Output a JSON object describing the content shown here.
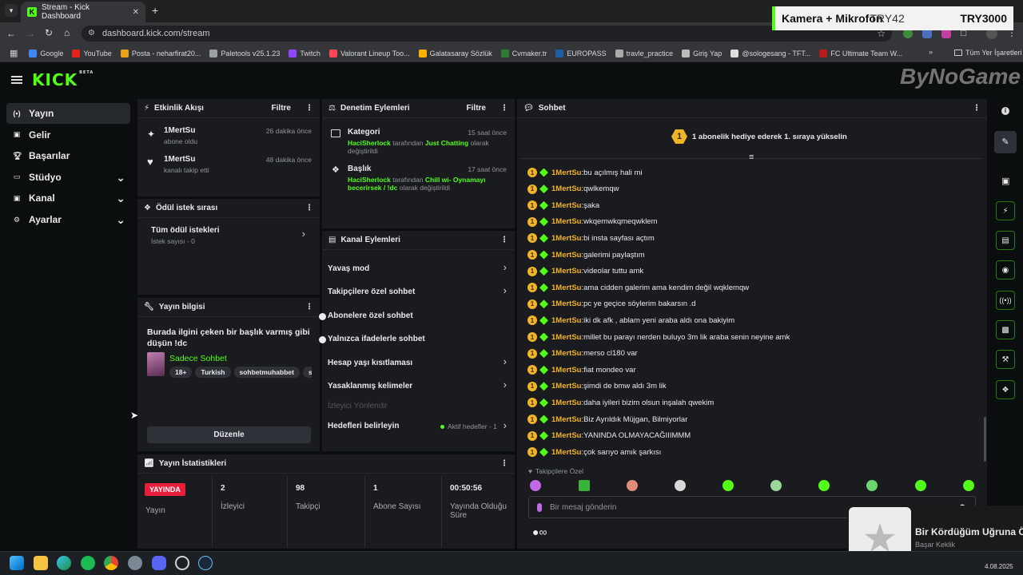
{
  "browser": {
    "tab_title": "Stream - Kick Dashboard",
    "url": "dashboard.kick.com/stream",
    "bookmarks": [
      "Google",
      "YouTube",
      "Posta - neharfirat20...",
      "Paletools v25.1.23",
      "Twitch",
      "Valorant Lineup Too...",
      "Galatasaray Sözlük",
      "Cvmaker.tr",
      "EUROPASS",
      "travle_practice",
      "Giriş Yap",
      "@sologesang - TFT...",
      "FC Ultimate Team W..."
    ],
    "bookmarks_more": "»",
    "all_bookmarks": "Tüm Yer İşaretleri"
  },
  "overlay": {
    "camera_label": "Kamera + Mikrofon",
    "price_a": "TRY42",
    "price_b": "TRY3000",
    "watermark": "ByNoGame"
  },
  "app": {
    "logo": "KICK",
    "logo_beta": "BETA"
  },
  "sidebar": {
    "items": [
      {
        "label": "Yayın",
        "icon": "broadcast-icon",
        "expand": false
      },
      {
        "label": "Gelir",
        "icon": "revenue-icon",
        "expand": false
      },
      {
        "label": "Başarılar",
        "icon": "trophy-icon",
        "expand": false
      },
      {
        "label": "Stüdyo",
        "icon": "studio-icon",
        "expand": true
      },
      {
        "label": "Kanal",
        "icon": "channel-icon",
        "expand": true
      },
      {
        "label": "Ayarlar",
        "icon": "settings-icon",
        "expand": true
      }
    ]
  },
  "activity": {
    "title": "Etkinlik Akışı",
    "filter": "Filtre",
    "events": [
      {
        "user": "1MertSu",
        "action": "abone oldu",
        "time": "26 dakika önce"
      },
      {
        "user": "1MertSu",
        "action": "kanalı takip etti",
        "time": "48 dakika önce"
      }
    ]
  },
  "moderation": {
    "title": "Denetim Eylemleri",
    "filter": "Filtre",
    "items": [
      {
        "title": "Kategori",
        "time": "15 saat önce",
        "mod": "HaciSherlock",
        "mid": " tarafından ",
        "value": "Just Chatting",
        "tail": " olarak değiştirildi"
      },
      {
        "title": "Başlık",
        "time": "17 saat önce",
        "mod": "HaciSherlock",
        "mid": " tarafından ",
        "value": "Chill wi- Oynamayı becerirsek / !dc",
        "tail": " olarak değiştirildi"
      }
    ]
  },
  "rewards": {
    "title": "Ödül istek sırası",
    "all": "Tüm ödül istekleri",
    "count": "İstek sayısı - 0"
  },
  "stream_info": {
    "title": "Yayın bilgisi",
    "stream_title": "Burada ilgini çeken bir başlık varmış gibi düşün !dc",
    "category": "Sadece Sohbet",
    "tags": [
      "18+",
      "Turkish",
      "sohbetmuhabbet",
      "sıkıl"
    ],
    "edit": "Düzenle"
  },
  "channel_actions": {
    "title": "Kanal Eylemleri",
    "items": [
      {
        "label": "Yavaş mod",
        "type": "chevron"
      },
      {
        "label": "Takipçilere özel sohbet",
        "type": "chevron"
      },
      {
        "label": "Abonelere özel sohbet",
        "type": "toggle"
      },
      {
        "label": "Yalnızca ifadelerle sohbet",
        "type": "toggle"
      },
      {
        "label": "Hesap yaşı kısıtlaması",
        "type": "chevron"
      },
      {
        "label": "Yasaklanmış kelimeler",
        "type": "chevron"
      }
    ],
    "viewer_redirect": "İzleyici Yönlendir",
    "goals": "Hedefleri belirleyin",
    "goals_status": "Aktif hedefler - 1"
  },
  "stats": {
    "title": "Yayın İstatistikleri",
    "live_badge": "YAYINDA",
    "cols": [
      {
        "value": "",
        "label": "Yayın"
      },
      {
        "value": "2",
        "label": "İzleyici"
      },
      {
        "value": "98",
        "label": "Takipçi"
      },
      {
        "value": "1",
        "label": "Abone Sayısı"
      },
      {
        "value": "00:50:56",
        "label": "Yayında Olduğu Süre"
      }
    ]
  },
  "chat": {
    "title": "Sohbet",
    "pinned_badge": "1",
    "pinned": "1 abonelik hediye ederek 1. sıraya yükselin",
    "messages": [
      {
        "user": "1MertSu",
        "text": "bu açılmış hali mi"
      },
      {
        "user": "1MertSu",
        "text": "qwlkemqw"
      },
      {
        "user": "1MertSu",
        "text": "şaka"
      },
      {
        "user": "1MertSu",
        "text": "wkqemwkqmeqwklem"
      },
      {
        "user": "1MertSu",
        "text": "bi insta sayfası açtım"
      },
      {
        "user": "1MertSu",
        "text": "galerimi paylaştım"
      },
      {
        "user": "1MertSu",
        "text": "videolar tuttu amk"
      },
      {
        "user": "1MertSu",
        "text": "ama cidden galerim ama kendim değil wqklemqw"
      },
      {
        "user": "1MertSu",
        "text": "pc ye geçice söylerim bakarsın .d"
      },
      {
        "user": "1MertSu",
        "text": "iki dk afk , ablam yeni araba aldı ona bakiyim"
      },
      {
        "user": "1MertSu",
        "text": "millet bu parayı nerden buluyo 3m lik araba senin neyine amk"
      },
      {
        "user": "1MertSu",
        "text": "merso cl180 var"
      },
      {
        "user": "1MertSu",
        "text": "fiat mondeo var"
      },
      {
        "user": "1MertSu",
        "text": "şimdi de bmw aldı 3m lik"
      },
      {
        "user": "1MertSu",
        "text": "daha iyileri bizim olsun inşalah qwekim"
      },
      {
        "user": "1MertSu",
        "text": "Biz Ayrıldık Müjgan, Bilmiyorlar"
      },
      {
        "user": "1MertSu",
        "text": "YANINDA OLMAYACAĞIIIMMM"
      },
      {
        "user": "1MertSu",
        "text": "çok sarıyo amık şarkısı"
      }
    ],
    "mode": "Takipçilere Özel",
    "input_placeholder": "Bir mesaj gönderin"
  },
  "toast": {
    "title": "Bir Kördüğüm Uğruna Öl",
    "artist": "Başar Keklik"
  },
  "taskbar": {
    "date": "4.08.2025"
  },
  "colors": {
    "brand": "#53fc18",
    "gold": "#f0b429",
    "live": "#e91e3a"
  }
}
